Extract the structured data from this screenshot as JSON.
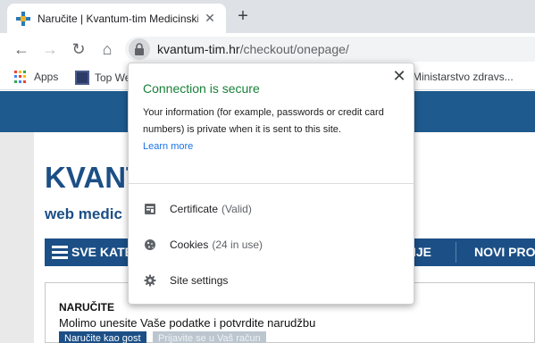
{
  "tab": {
    "title": "Naručite | Kvantum-tim Medicinski",
    "close": "✕",
    "new_tab": "+"
  },
  "toolbar": {
    "back": "←",
    "forward": "→",
    "reload": "↻",
    "home": "⌂"
  },
  "omnibox": {
    "domain": "kvantum-tim.hr",
    "path": "/checkout/onepage/"
  },
  "bookmarks": {
    "apps": "Apps",
    "top": "Top We",
    "ministry": "Ministarstvo zdravs..."
  },
  "site": {
    "logo_main": "KVANT",
    "logo_sub": "web medic",
    "nav": {
      "categories": "SVE KATE",
      "item2": "IJE",
      "item3": "NOVI PRO"
    },
    "checkout": {
      "title": "NARUČITE",
      "subtitle": "Molimo unesite Vaše podatke i potvrdite narudžbu",
      "guest_btn": "Naručite kao gost",
      "login_btn": "Prijavite se u Vaš račun"
    }
  },
  "popup": {
    "close": "✕",
    "title": "Connection is secure",
    "description": "Your information (for example, passwords or credit card numbers) is private when it is sent to this site.",
    "learn_more": "Learn more",
    "items": [
      {
        "label": "Certificate",
        "detail": "(Valid)",
        "icon": "certificate-icon"
      },
      {
        "label": "Cookies",
        "detail": "(24 in use)",
        "icon": "cookie-icon"
      },
      {
        "label": "Site settings",
        "detail": "",
        "icon": "gear-icon"
      }
    ],
    "colors": {
      "secure_green": "#188038",
      "link_blue": "#1a73e8"
    }
  },
  "colors": {
    "site_blue": "#1c4f86",
    "band_blue": "#1f5a8e"
  }
}
